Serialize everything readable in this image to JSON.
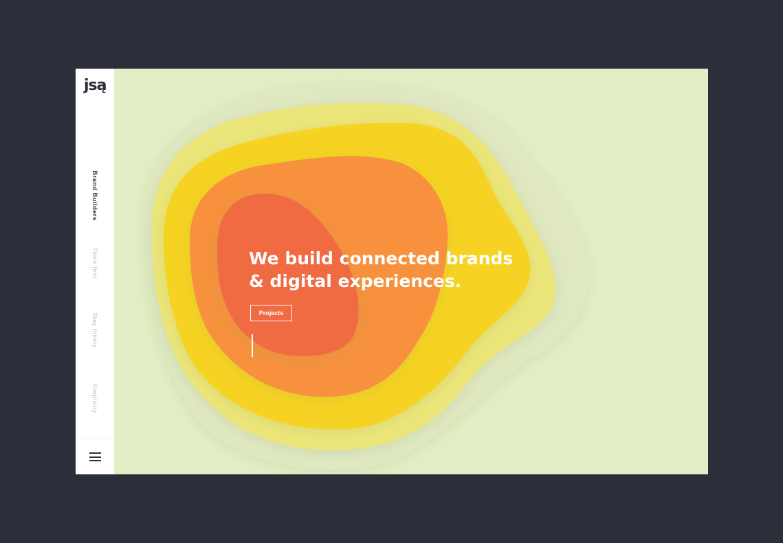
{
  "brand": {
    "logo_text": "jsą"
  },
  "sidebar": {
    "items": [
      {
        "label": "Brand Builders",
        "active": true
      },
      {
        "label": "Think first",
        "active": false
      },
      {
        "label": "Stay thirsty",
        "active": false
      },
      {
        "label": "Simplicity",
        "active": false
      }
    ],
    "menu_icon": "hamburger-icon"
  },
  "hero": {
    "title_line1": "We build connected brands",
    "title_line2": "& digital experiences.",
    "cta_label": "Projects"
  },
  "colors": {
    "page_background": "#2a2f3a",
    "canvas_background": "#e2efc6",
    "blob_outer": "#dfe8c1",
    "blob_light_yellow": "#ece67a",
    "blob_yellow": "#f6d322",
    "blob_orange": "#f7913c",
    "blob_red_orange": "#f06a43",
    "text_light": "#ffffff",
    "text_dark": "#2a2f3a",
    "nav_muted": "#b7bcc2"
  }
}
